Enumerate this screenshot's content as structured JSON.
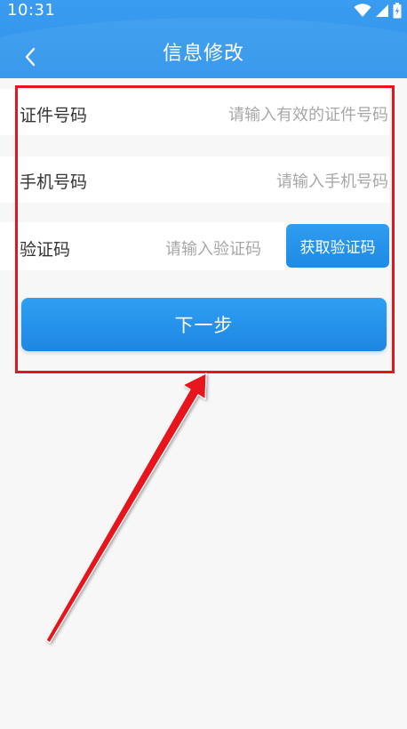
{
  "status_bar": {
    "time": "10:31"
  },
  "header": {
    "title": "信息修改",
    "background_color": "#2e93ea"
  },
  "form": {
    "id_number": {
      "label": "证件号码",
      "placeholder": "请输入有效的证件号码"
    },
    "phone": {
      "label": "手机号码",
      "placeholder": "请输入手机号码"
    },
    "verification_code": {
      "label": "验证码",
      "placeholder": "请输入验证码",
      "button_label": "获取验证码"
    },
    "next_label": "下一步"
  },
  "icons": {
    "back": "chevron-left-icon",
    "wifi": "wifi-icon",
    "signal": "signal-icon",
    "battery": "battery-icon"
  },
  "colors": {
    "accent": "#1e8ae4",
    "annotation": "#e8141c",
    "page_background": "#f7f7f7"
  }
}
